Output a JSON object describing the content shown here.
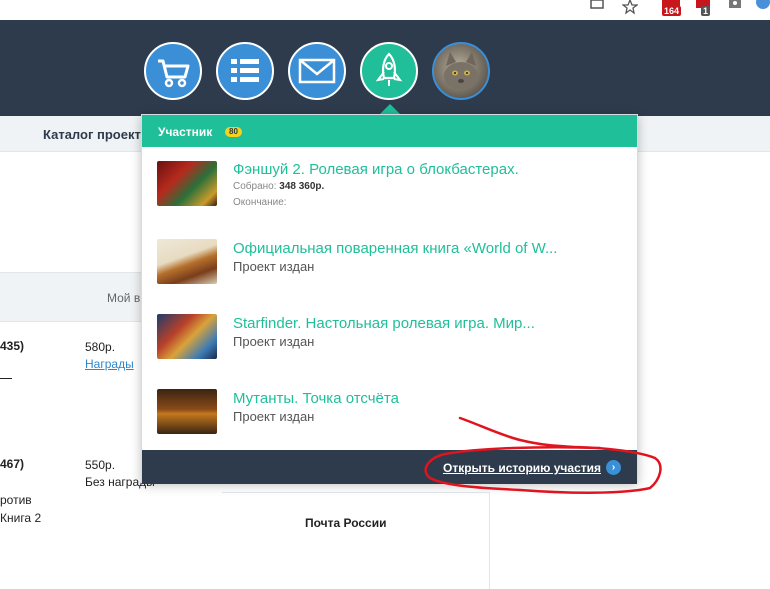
{
  "browser": {
    "extensions": [
      {
        "name": "cast-icon"
      },
      {
        "name": "star-icon"
      },
      {
        "name": "calendar-ext-icon",
        "badge": "164"
      },
      {
        "name": "adblock-ext-icon",
        "badge": "1"
      },
      {
        "name": "camera-ext-icon"
      },
      {
        "name": "ext-blue-icon"
      }
    ]
  },
  "header": {
    "icons": [
      "cart-icon",
      "list-icon",
      "mail-icon",
      "rocket-icon",
      "avatar"
    ]
  },
  "page": {
    "nav_catalog": "Каталог проектов",
    "my_label": "Мой в",
    "rows": [
      {
        "id": "435)",
        "price": "580р.",
        "reward": "Награды"
      },
      {
        "id": "467)",
        "price": "550р.",
        "reward": "Без награды",
        "extra1": "ротив",
        "extra2": "Книга 2"
      }
    ],
    "delivery": "Почта России"
  },
  "panel": {
    "title": "Участник",
    "level": "80",
    "items": [
      {
        "title": "Фэншуй 2. Ролевая игра о блокбастерах.",
        "collected_label": "Собрано:",
        "collected_value": "348 360р.",
        "end_label": "Окончание:"
      },
      {
        "title": "Официальная поваренная книга «World of W...",
        "status": "Проект издан"
      },
      {
        "title": "Starfinder. Настольная ролевая игра. Мир...",
        "status": "Проект издан"
      },
      {
        "title": "Мутанты. Точка отсчёта",
        "status": "Проект издан"
      }
    ],
    "footer_link": "Открыть историю участия"
  },
  "colors": {
    "header_bg": "#2d3b4c",
    "accent_green": "#1fbf9a",
    "accent_blue": "#3a8fd6",
    "badge_yellow": "#f5d31b",
    "annotation_red": "#e0141e"
  }
}
